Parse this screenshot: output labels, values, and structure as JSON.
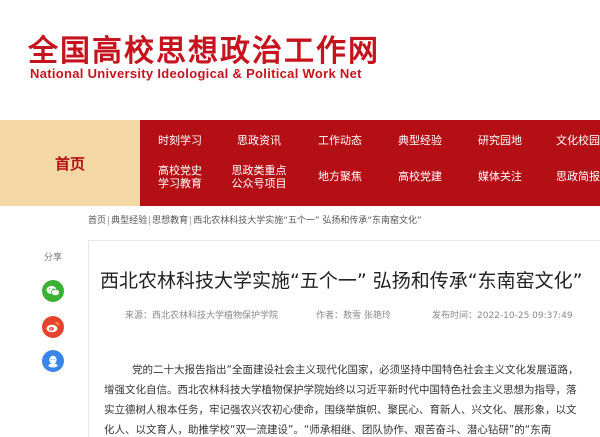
{
  "header": {
    "logo_cn": "全国高校思想政治工作网",
    "logo_en": "National University Ideological & Political Work Net"
  },
  "nav": {
    "home": "首页",
    "row1": [
      "时刻学习",
      "思政资讯",
      "工作动态",
      "典型经验",
      "研究园地",
      "文化校园"
    ],
    "row2": [
      "高校党史学习教育",
      "思政类重点公众号项目",
      "地方聚焦",
      "高校党建",
      "媒体关注",
      "思政简报"
    ]
  },
  "breadcrumb": [
    "首页",
    "典型经验",
    "思想教育",
    "西北农林科技大学实施“五个一” 弘扬和传承“东南窑文化”"
  ],
  "share": {
    "label": "分享",
    "buttons": [
      "wechat-icon",
      "weibo-icon",
      "qq-icon"
    ]
  },
  "article": {
    "title": "西北农林科技大学实施“五个一” 弘扬和传承“东南窑文化”",
    "source": "来源：西北农林科技大学植物保护学院",
    "author": "作者：敖雪 张艳玲",
    "date": "发布时间：2022-10-25 09:37:49",
    "body_lines": [
      "党的二十大报告指出“全面建设社会主义现代化国家，必须坚持中国特色社会主义文化发展道路，",
      "增强文化自信。西北农林科技大学植物保护学院始终以习近平新时代中国特色社会主义思想为指导，落",
      "实立德树人根本任务，牢记强农兴农初心使命，围绕举旗帜、聚民心、育新人、兴文化、展形象，以文",
      "化人、以文育人，助推学校“双一流建设”。“师承相继、团队协作、艰苦奋斗、潜心钻研”的“东南"
    ]
  },
  "colors": {
    "brand_red": "#b50f16",
    "home_tab": "#f3d7a4",
    "wechat": "#3cb034",
    "weibo": "#e6432e",
    "qq": "#3a86e8"
  }
}
